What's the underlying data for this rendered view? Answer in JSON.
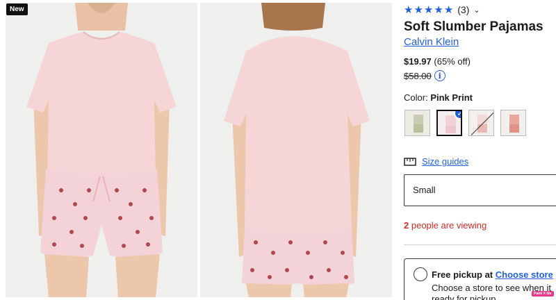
{
  "gallery": {
    "badge": "New",
    "images": [
      {
        "alt": "front",
        "icon": "model-front-image"
      },
      {
        "alt": "back",
        "icon": "model-back-image"
      }
    ]
  },
  "product": {
    "rating_count": "(3)",
    "stars": 5,
    "title": "Soft Slumber Pajamas",
    "brand": "Calvin Klein",
    "price_now": "$19.97",
    "discount": "(65% off)",
    "price_was": "$58.00",
    "color_label": "Color:",
    "color_value": "Pink Print",
    "size_guides": "Size guides",
    "size_selected": "Small",
    "viewing_count": "2",
    "viewing_text": "people are viewing",
    "pickup_title": "Free pickup at",
    "pickup_link": "Choose store",
    "pickup_sub_1": "Choose a store to see when it",
    "pickup_sub_2": "ready for pickup"
  },
  "overlay": {
    "badge": "Paint X lite"
  },
  "colors": {
    "accent": "#2160dd",
    "alert": "#d32a2a",
    "shirt": "#f6d5d6"
  }
}
